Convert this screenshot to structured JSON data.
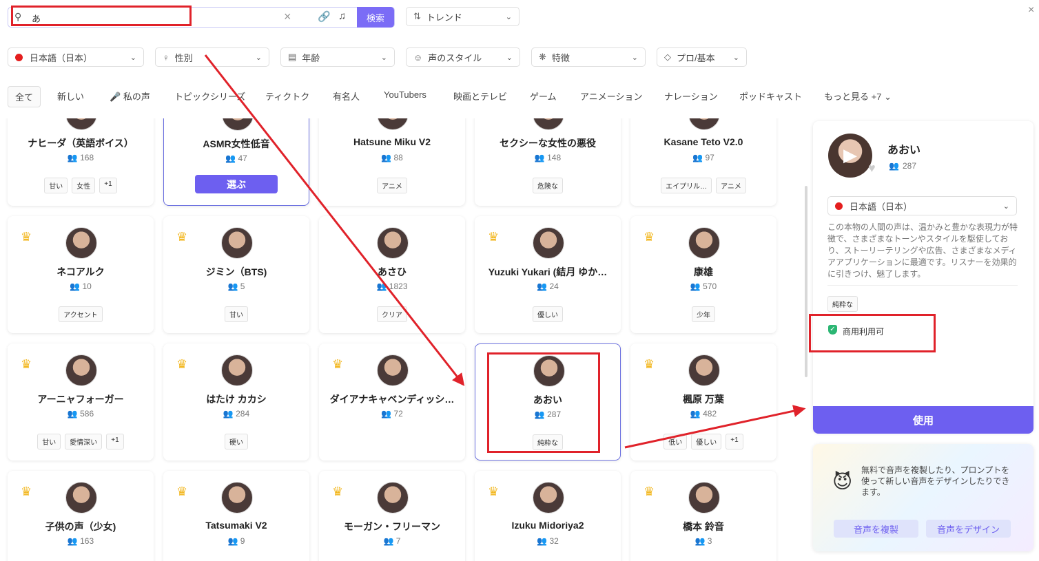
{
  "search": {
    "value": "あ",
    "button": "検索"
  },
  "sort": {
    "label": "トレンド"
  },
  "filters": [
    {
      "label": "日本語（日本）",
      "icon": "flag-japan-icon"
    },
    {
      "label": "性別",
      "icon": "gender-icon"
    },
    {
      "label": "年齢",
      "icon": "cake-icon"
    },
    {
      "label": "声のスタイル",
      "icon": "smile-icon"
    },
    {
      "label": "特徴",
      "icon": "sparkle-icon"
    },
    {
      "label": "プロ/基本",
      "icon": "diamond-icon"
    }
  ],
  "tabs": [
    "全て",
    "新しい",
    "私の声",
    "トピックシリーズ",
    "ティクトク",
    "有名人",
    "YouTubers",
    "映画とテレビ",
    "ゲーム",
    "アニメーション",
    "ナレーション",
    "ポッドキャスト",
    "もっと見る +7"
  ],
  "cards": [
    {
      "name": "ナヒーダ（英語ボイス）",
      "count": "168",
      "tags": [
        "甘い",
        "女性",
        "+1"
      ],
      "crown": false
    },
    {
      "name": "ASMR女性低音",
      "count": "47",
      "tags": [],
      "crown": false,
      "select": "選ぶ"
    },
    {
      "name": "Hatsune Miku V2",
      "count": "88",
      "tags": [
        "アニメ"
      ],
      "crown": false
    },
    {
      "name": "セクシーな女性の悪役",
      "count": "148",
      "tags": [
        "危険な"
      ],
      "crown": false
    },
    {
      "name": "Kasane Teto V2.0",
      "count": "97",
      "tags": [
        "エイプリル…",
        "アニメ"
      ],
      "crown": false
    },
    {
      "name": "ネコアルク",
      "count": "10",
      "tags": [
        "アクセント"
      ],
      "crown": true
    },
    {
      "name": "ジミン（BTS)",
      "count": "5",
      "tags": [
        "甘い"
      ],
      "crown": true
    },
    {
      "name": "あさひ",
      "count": "1823",
      "tags": [
        "クリア"
      ],
      "crown": false
    },
    {
      "name": "Yuzuki Yukari (結月 ゆか…",
      "count": "24",
      "tags": [
        "優しい"
      ],
      "crown": true
    },
    {
      "name": "康雄",
      "count": "570",
      "tags": [
        "少年"
      ],
      "crown": true
    },
    {
      "name": "アーニャフォーガー",
      "count": "586",
      "tags": [
        "甘い",
        "愛情深い",
        "+1"
      ],
      "crown": true
    },
    {
      "name": "はたけ カカシ",
      "count": "284",
      "tags": [
        "硬い"
      ],
      "crown": true
    },
    {
      "name": "ダイアナキャベンディッシ…",
      "count": "72",
      "tags": [],
      "crown": true
    },
    {
      "name": "あおい",
      "count": "287",
      "tags": [
        "純粋な"
      ],
      "crown": false
    },
    {
      "name": "楓原 万葉",
      "count": "482",
      "tags": [
        "低い",
        "優しい",
        "+1"
      ],
      "crown": true
    },
    {
      "name": "子供の声（少女)",
      "count": "163",
      "tags": [],
      "crown": true
    },
    {
      "name": "Tatsumaki V2",
      "count": "9",
      "tags": [],
      "crown": true
    },
    {
      "name": "モーガン・フリーマン",
      "count": "7",
      "tags": [],
      "crown": true
    },
    {
      "name": "Izuku Midoriya2",
      "count": "32",
      "tags": [],
      "crown": true
    },
    {
      "name": "橋本 鈴音",
      "count": "3",
      "tags": [],
      "crown": true
    }
  ],
  "panel": {
    "name": "あおい",
    "count": "287",
    "language": "日本語（日本）",
    "description": "この本物の人間の声は、温かみと豊かな表現力が特徴で、さまざまなトーンやスタイルを駆使しており、ストーリーテリングや広告、さまざまなメディアアプリケーションに最適です。リスナーを効果的に引きつけ、魅了します。",
    "tag": "純粋な",
    "commercial": "商用利用可",
    "use": "使用"
  },
  "promo": {
    "text": "無料で音声を複製したり、プロンプトを使って新しい音声をデザインしたりできます。",
    "clone": "音声を複製",
    "design": "音声をデザイン"
  }
}
